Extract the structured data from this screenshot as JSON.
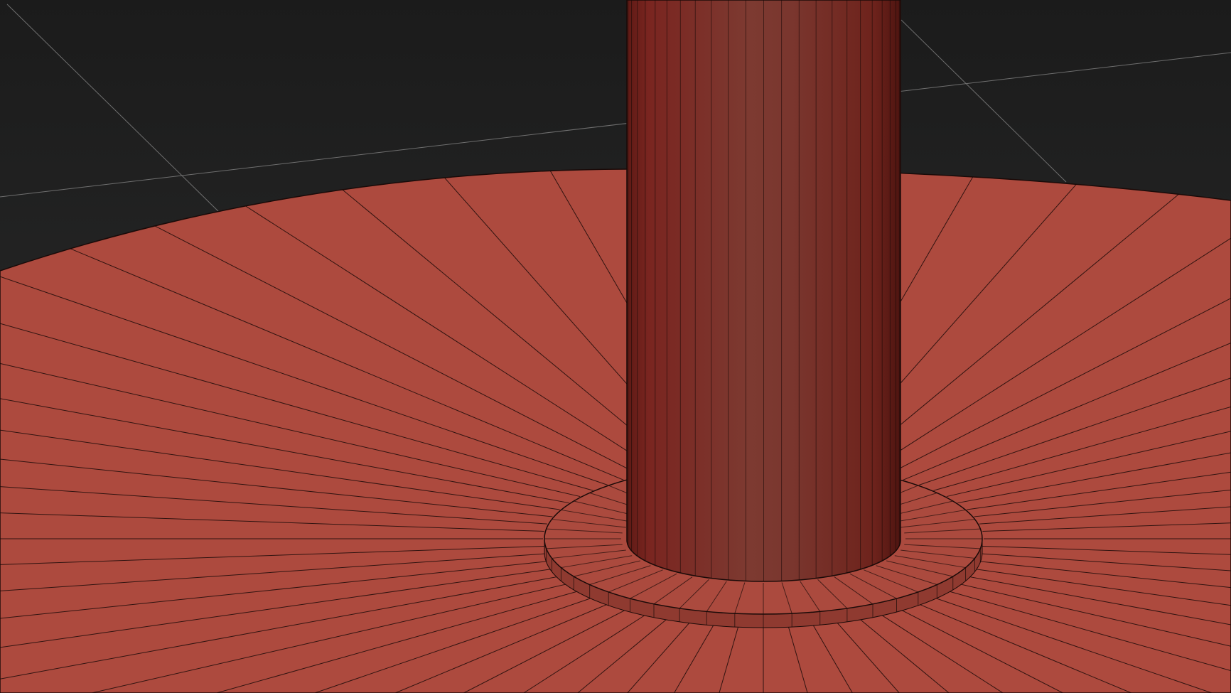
{
  "viewport": {
    "colors": {
      "background_top": "#1b1b1b",
      "background_bottom": "#2e2f2f",
      "grid_line": "#8a8a8a",
      "disc_fill": "#ad4a3e",
      "column_dark": "#6e221c",
      "column_mid": "#7b352d",
      "ring_top": "#ab4a3e",
      "ring_side": "#8f3a30",
      "edge": "#1a0a08"
    },
    "disc_segments": 64,
    "column_segments": 24,
    "ring_segments": 48
  }
}
